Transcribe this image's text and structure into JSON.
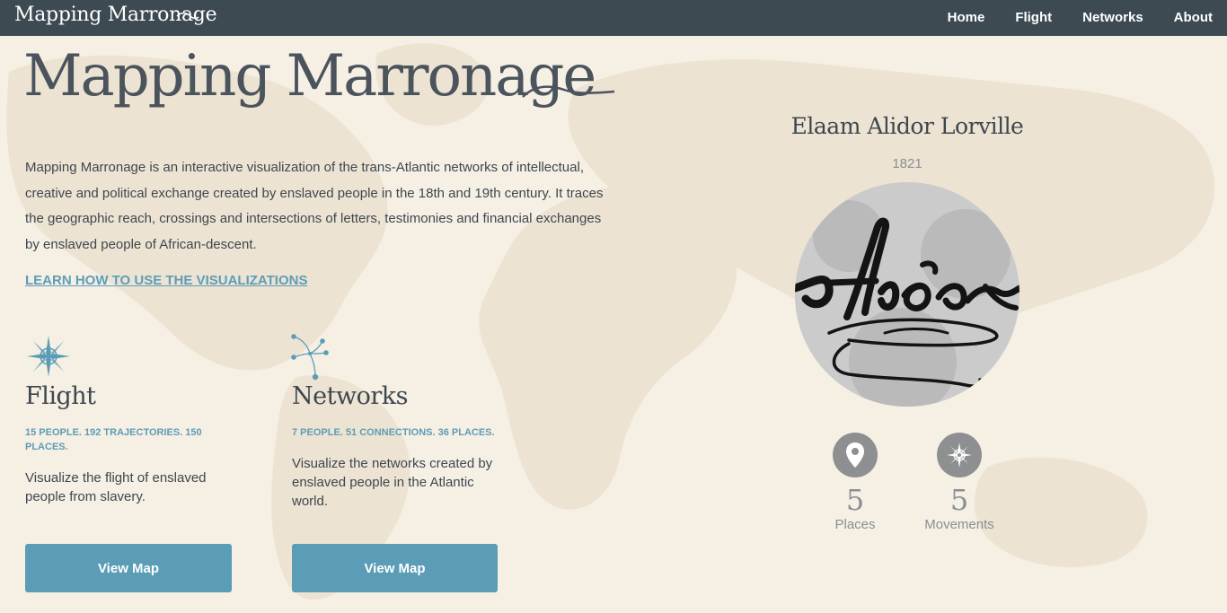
{
  "nav": {
    "brand": "Mapping Marronage",
    "links": [
      "Home",
      "Flight",
      "Networks",
      "About"
    ]
  },
  "hero": {
    "title": "Mapping Marronage",
    "intro": "Mapping Marronage is an interactive visualization of the trans-Atlantic networks of intellectual, creative and political exchange created by enslaved people in the 18th and 19th century. It traces the geographic reach, crossings and intersections of letters, testimonies and financial exchanges by enslaved people of African-descent.",
    "learn_link": "LEARN HOW TO USE THE VISUALIZATIONS"
  },
  "features": {
    "flight": {
      "icon": "compass-rose-icon",
      "title": "Flight",
      "stats": "15 PEOPLE. 192 TRAJECTORIES. 150 PLACES.",
      "description": "Visualize the flight of enslaved people from slavery.",
      "button": "View Map"
    },
    "networks": {
      "icon": "network-nodes-icon",
      "title": "Networks",
      "stats": "7 PEOPLE. 51 CONNECTIONS. 36 PLACES.",
      "description": "Visualize the networks created by enslaved people in the Atlantic world.",
      "button": "View Map"
    }
  },
  "person": {
    "name": "Elaam Alidor Lorville",
    "year": "1821",
    "portrait": "signature-image",
    "metrics": {
      "places": {
        "value": "5",
        "label": "Places",
        "icon": "map-pin-icon"
      },
      "movements": {
        "value": "5",
        "label": "Movements",
        "icon": "compass-icon"
      }
    }
  },
  "colors": {
    "nav_bg": "#3d4a52",
    "page_bg": "#f5efe4",
    "accent": "#5b9db6",
    "text": "#3e474f",
    "muted": "#8a8f94"
  }
}
